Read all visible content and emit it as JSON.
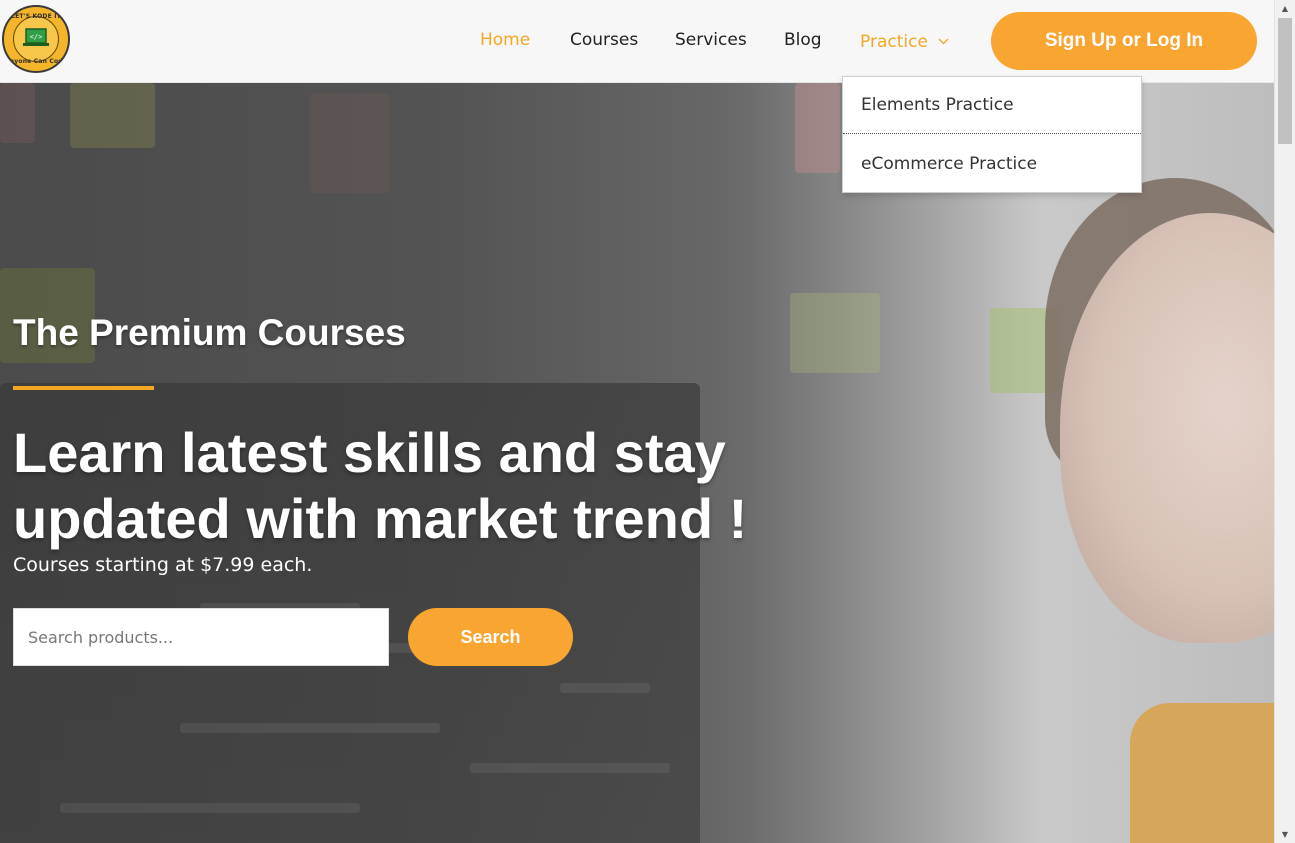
{
  "header": {
    "logo": {
      "top_text": "LET'S KODE IT",
      "bottom_text": "Anyone Can Code"
    },
    "nav": [
      {
        "label": "Home",
        "state": "active"
      },
      {
        "label": "Courses"
      },
      {
        "label": "Services"
      },
      {
        "label": "Blog"
      },
      {
        "label": "Practice",
        "icon": "chevron-down-icon",
        "state": "open"
      }
    ],
    "signup_label": "Sign Up or Log In"
  },
  "dropdown": {
    "items": [
      "Elements Practice",
      "eCommerce Practice"
    ]
  },
  "hero": {
    "kicker": "The Premium Courses",
    "headline": "Learn latest skills and stay updated with market trend !",
    "subline": "Courses starting at $7.99 each.",
    "search_placeholder": "Search products...",
    "search_value": "",
    "search_button": "Search"
  },
  "colors": {
    "accent": "#f9a531",
    "nav_active": "#f5a623",
    "header_bg": "#f7f7f7"
  }
}
